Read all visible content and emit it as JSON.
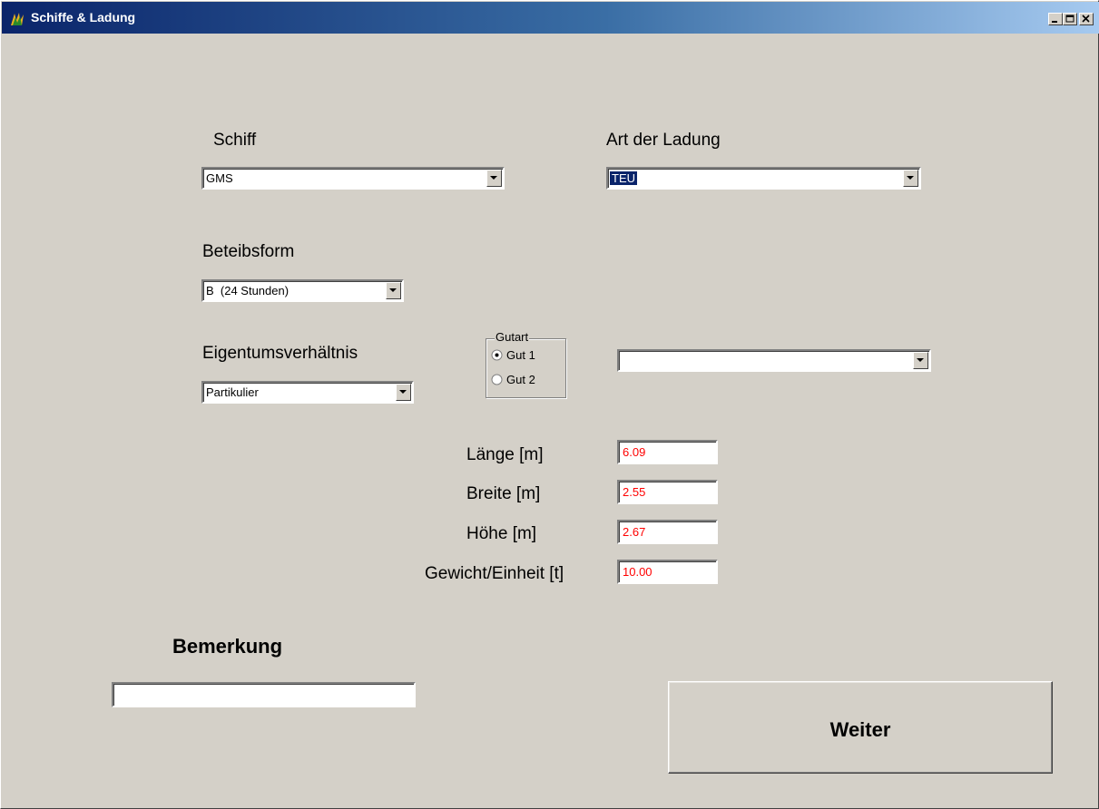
{
  "window": {
    "title": "Schiffe & Ladung",
    "buttons": {
      "minimize": "minimize-icon",
      "maximize": "maximize-icon",
      "close": "close-icon"
    }
  },
  "schiff": {
    "label": "Schiff",
    "value": "GMS"
  },
  "ladung": {
    "label": "Art der Ladung",
    "value": "TEU"
  },
  "betriebsform": {
    "label": "Beteibsform",
    "value": "B  (24 Stunden)"
  },
  "eigentum": {
    "label": "Eigentumsverhältnis",
    "value": "Partikulier"
  },
  "gutart": {
    "title": "Gutart",
    "options": [
      {
        "label": "Gut 1",
        "checked": true
      },
      {
        "label": "Gut 2",
        "checked": false
      }
    ]
  },
  "gut_select": {
    "value": ""
  },
  "dimensions": {
    "laenge": {
      "label": "Länge [m]",
      "value": "6.09"
    },
    "breite": {
      "label": "Breite [m]",
      "value": "2.55"
    },
    "hoehe": {
      "label": "Höhe [m]",
      "value": "2.67"
    },
    "gewicht": {
      "label": "Gewicht/Einheit [t]",
      "value": "10.00"
    }
  },
  "bemerkung": {
    "label": "Bemerkung",
    "value": ""
  },
  "weiter_button": {
    "label": "Weiter"
  },
  "colors": {
    "titlebar_start": "#0a246a",
    "titlebar_end": "#a6caf0",
    "face": "#d4d0c8",
    "value_text": "#ff0000"
  }
}
